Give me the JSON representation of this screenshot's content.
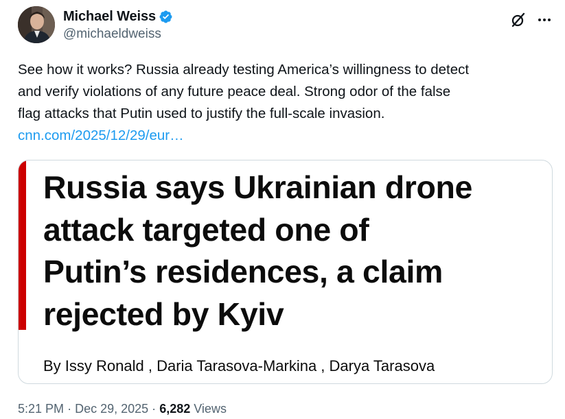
{
  "author": {
    "display_name": "Michael Weiss",
    "handle": "@michaeldweiss",
    "verified": true,
    "avatar_icon": "profile-photo"
  },
  "actions": {
    "grok_icon": "grok-icon",
    "more_icon": "more-dots-icon"
  },
  "tweet": {
    "text_lines": [
      "See how it works? Russia already testing America’s willingness to detect",
      "and verify violations of any future peace deal. Strong odor of the false",
      "flag attacks that Putin used to justify the full-scale invasion."
    ],
    "link_text": "cnn.com/2025/12/29/eur…"
  },
  "card": {
    "headline_lines": [
      "Russia says Ukrainian drone",
      "attack targeted one of",
      "Putin’s residences, a claim",
      "rejected by Kyiv"
    ],
    "byline": "By Issy Ronald , Daria Tarasova-Markina , Darya Tarasova",
    "accent_color": "#cc0000"
  },
  "meta": {
    "time": "5:21 PM",
    "separator": "·",
    "date": "Dec 29, 2025",
    "views_count": "6,282",
    "views_label": "Views"
  },
  "colors": {
    "link": "#1d9bf0",
    "secondary_text": "#536471",
    "primary_text": "#0f1419",
    "verified_badge": "#1d9bf0",
    "border": "#cfd9de"
  }
}
